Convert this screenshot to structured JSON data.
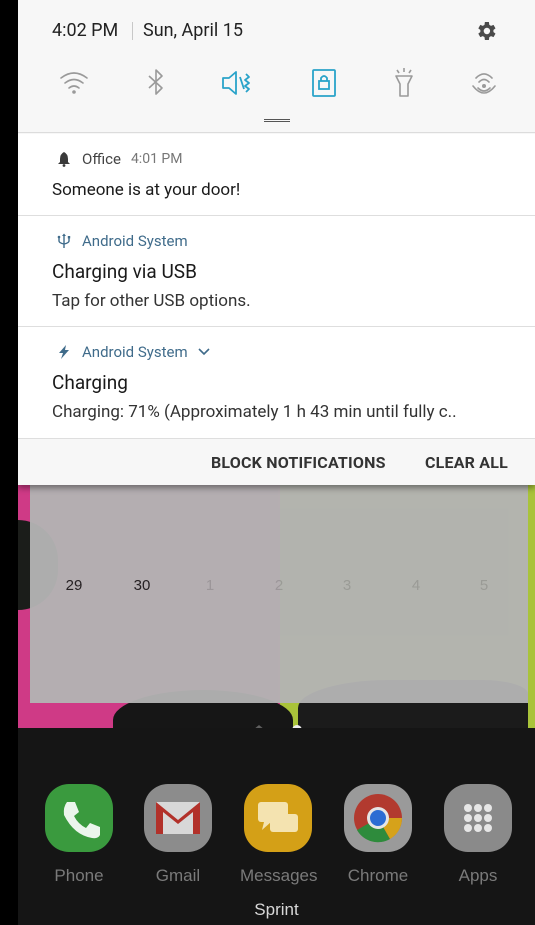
{
  "status": {
    "time": "4:02 PM",
    "date": "Sun, April 15"
  },
  "quick_settings": {
    "toggles": [
      {
        "name": "wifi-icon",
        "active": false
      },
      {
        "name": "bluetooth-icon",
        "active": false
      },
      {
        "name": "vibrate-icon",
        "active": true
      },
      {
        "name": "screen-rotation-lock-icon",
        "active": true
      },
      {
        "name": "flashlight-icon",
        "active": false
      },
      {
        "name": "nfc-icon",
        "active": false
      }
    ],
    "accent_color": "#2aa3c9"
  },
  "notifications": [
    {
      "app": "Office",
      "time": "4:01 PM",
      "title": "",
      "text": "Someone is at your door!"
    },
    {
      "app": "Android System",
      "title": "Charging via USB",
      "text": "Tap for other USB options."
    },
    {
      "app": "Android System",
      "title": "Charging",
      "text": "Charging: 71% (Approximately 1 h 43 min until fully c.."
    }
  ],
  "actions": {
    "block": "BLOCK NOTIFICATIONS",
    "clear": "CLEAR ALL"
  },
  "calendar": {
    "days": [
      "29",
      "30",
      "1",
      "2",
      "3",
      "4",
      "5"
    ]
  },
  "dock": {
    "apps": [
      "Phone",
      "Gmail",
      "Messages",
      "Chrome",
      "Apps"
    ],
    "carrier": "Sprint"
  }
}
